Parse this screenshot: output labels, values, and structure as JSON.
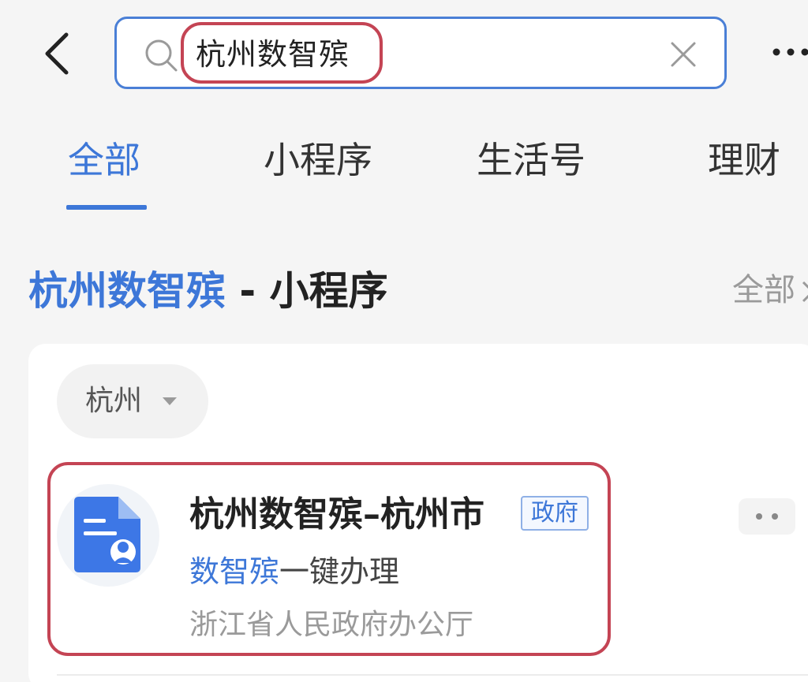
{
  "search": {
    "query": "杭州数智殡"
  },
  "tabs": [
    {
      "label": "全部",
      "active": true
    },
    {
      "label": "小程序",
      "active": false
    },
    {
      "label": "生活号",
      "active": false
    },
    {
      "label": "理财",
      "active": false
    }
  ],
  "section": {
    "title_keyword": "杭州数智殡",
    "title_rest": " - 小程序",
    "more_label": "全部"
  },
  "filter": {
    "city": "杭州"
  },
  "result": {
    "name": "杭州数智殡–杭州市",
    "badge": "政府",
    "desc_keyword": "数智殡",
    "desc_rest": "一键办理",
    "provider": "浙江省人民政府办公厅"
  },
  "colors": {
    "accent": "#3d77d8",
    "highlight_outline": "#c44454",
    "background": "#f5f5f5"
  },
  "icons": [
    "back-arrow-icon",
    "search-icon",
    "clear-icon",
    "more-dots-icon",
    "chevron-right-icon",
    "caret-down-icon",
    "document-person-icon"
  ]
}
